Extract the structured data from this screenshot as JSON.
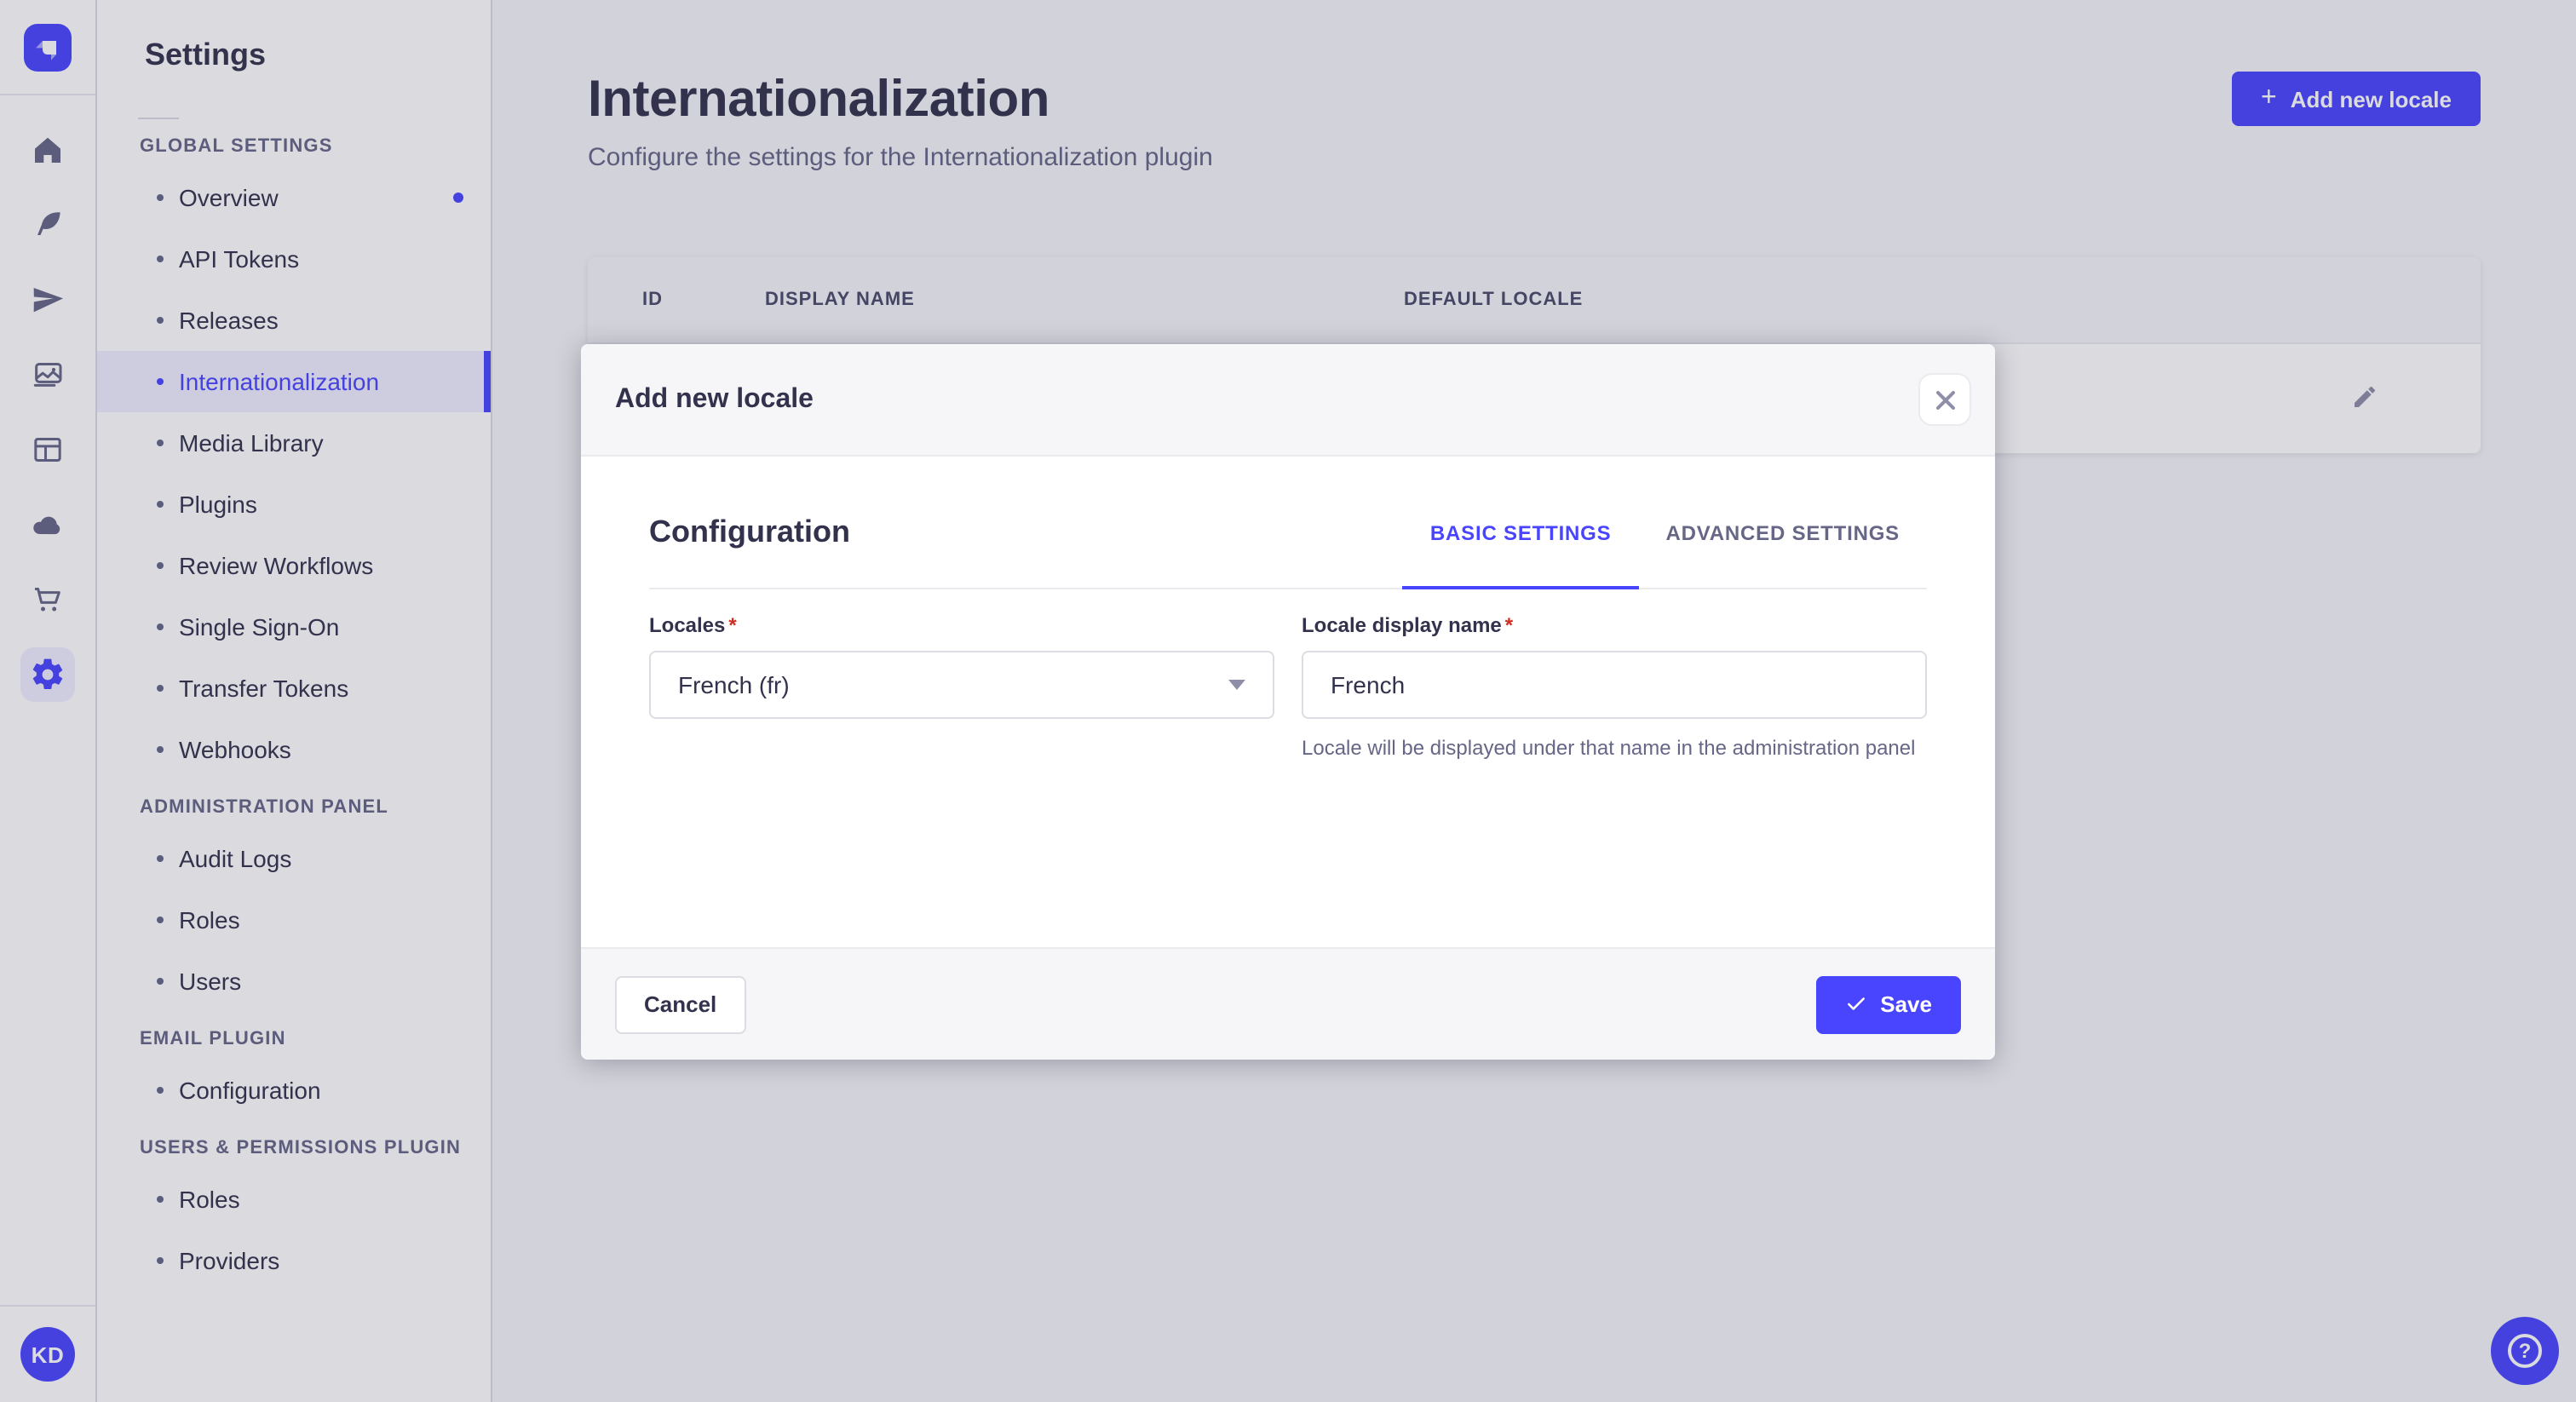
{
  "colors": {
    "primary": "#4945FF",
    "primary_light_bg": "#F0F0FF",
    "page_bg": "#F6F6F9",
    "text_dark": "#32324D",
    "text_muted": "#666687",
    "border": "#DCDCE4",
    "required_red": "#D02B20",
    "overlay": "rgba(50,50,77,0.18)"
  },
  "rail": {
    "logo_icon": "strapi-logo",
    "icons": [
      "home-icon",
      "feather-icon",
      "paper-plane-icon",
      "media-library-icon",
      "layout-icon",
      "cloud-icon",
      "cart-icon",
      "settings-gear-icon"
    ],
    "active_icon": "settings-gear-icon",
    "avatar_initials": "KD"
  },
  "sidebar": {
    "title": "Settings",
    "sections": [
      {
        "label": "GLOBAL SETTINGS",
        "items": [
          {
            "label": "Overview",
            "has_notification": true
          },
          {
            "label": "API Tokens"
          },
          {
            "label": "Releases"
          },
          {
            "label": "Internationalization",
            "active": true
          },
          {
            "label": "Media Library"
          },
          {
            "label": "Plugins"
          },
          {
            "label": "Review Workflows"
          },
          {
            "label": "Single Sign-On"
          },
          {
            "label": "Transfer Tokens"
          },
          {
            "label": "Webhooks"
          }
        ]
      },
      {
        "label": "ADMINISTRATION PANEL",
        "items": [
          {
            "label": "Audit Logs"
          },
          {
            "label": "Roles"
          },
          {
            "label": "Users"
          }
        ]
      },
      {
        "label": "EMAIL PLUGIN",
        "items": [
          {
            "label": "Configuration"
          }
        ]
      },
      {
        "label": "USERS & PERMISSIONS PLUGIN",
        "items": [
          {
            "label": "Roles"
          },
          {
            "label": "Providers"
          }
        ]
      }
    ]
  },
  "header": {
    "title": "Internationalization",
    "subtitle": "Configure the settings for the Internationalization plugin",
    "add_button_label": "Add new locale"
  },
  "table": {
    "columns": [
      "ID",
      "DISPLAY NAME",
      "DEFAULT LOCALE"
    ],
    "row_action_icon": "edit-pencil-icon"
  },
  "modal": {
    "title": "Add new locale",
    "close_icon": "close-icon",
    "section_title": "Configuration",
    "tabs": [
      {
        "label": "BASIC SETTINGS",
        "active": true
      },
      {
        "label": "ADVANCED SETTINGS",
        "active": false
      }
    ],
    "required_mark": "*",
    "locales_label": "Locales",
    "locales_value": "French (fr)",
    "display_name_label": "Locale display name",
    "display_name_value": "French",
    "display_name_hint": "Locale will be displayed under that name in the administration panel",
    "cancel_label": "Cancel",
    "save_label": "Save"
  },
  "help_button": {
    "icon": "question-mark-icon"
  }
}
